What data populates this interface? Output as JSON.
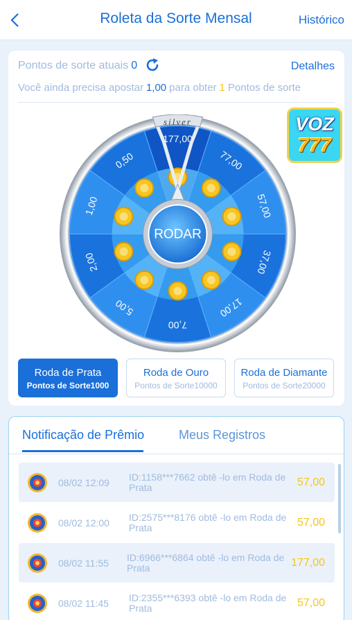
{
  "header": {
    "title": "Roleta da Sorte Mensal",
    "history_label": "Histórico"
  },
  "points": {
    "label": "Pontos de sorte atuais",
    "value": "0",
    "details_label": "Detalhes",
    "need_prefix": "Você ainda precisa apostar",
    "need_amount": "1,00",
    "need_middle": "para obter",
    "need_points": "1",
    "need_suffix": "Pontos de sorte"
  },
  "wheel": {
    "tier_label": "silver",
    "spin_label": "RODAR",
    "prizes": [
      "177,00",
      "77,00",
      "57,00",
      "37,00",
      "17,00",
      "7,00",
      "5,00",
      "2,00",
      "1,00",
      "0,50"
    ]
  },
  "logo": {
    "line1": "VOZ",
    "line2": "777"
  },
  "wheel_tabs": [
    {
      "name": "Roda de Prata",
      "points": "Pontos de Sorte1000",
      "active": true
    },
    {
      "name": "Roda de Ouro",
      "points": "Pontos de Sorte10000",
      "active": false
    },
    {
      "name": "Roda de Diamante",
      "points": "Pontos de Sorte20000",
      "active": false
    }
  ],
  "notifications": {
    "tab_prize": "Notificação de Prêmio",
    "tab_records": "Meus Registros",
    "rows": [
      {
        "time": "08/02 12:09",
        "desc": "ID:1158***7662 obtê -lo em Roda de Prata",
        "amount": "57,00"
      },
      {
        "time": "08/02 12:00",
        "desc": "ID:2575***8176 obtê -lo em Roda de Prata",
        "amount": "57,00"
      },
      {
        "time": "08/02 11:55",
        "desc": "ID:6966***6864 obtê -lo em Roda de Prata",
        "amount": "177,00"
      },
      {
        "time": "08/02 11:45",
        "desc": "ID:2355***6393 obtê -lo em Roda de Prata",
        "amount": "57,00"
      }
    ]
  },
  "colors": {
    "primary": "#1a6fd9",
    "muted": "#9fbbdd",
    "gold": "#f5c518",
    "background": "#e9f1fb"
  }
}
